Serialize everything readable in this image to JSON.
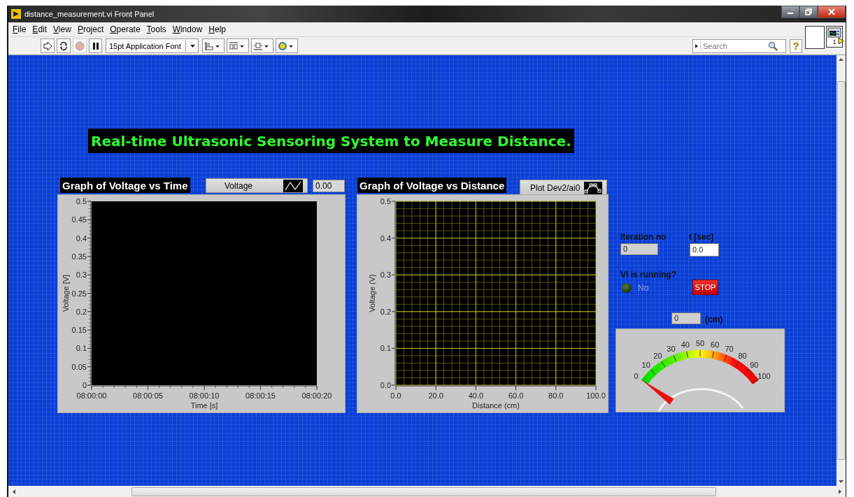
{
  "window": {
    "title": "distance_measurement.vi Front Panel"
  },
  "menu": [
    {
      "label": "File"
    },
    {
      "label": "Edit"
    },
    {
      "label": "View"
    },
    {
      "label": "Project"
    },
    {
      "label": "Operate"
    },
    {
      "label": "Tools"
    },
    {
      "label": "Window"
    },
    {
      "label": "Help"
    }
  ],
  "toolbar": {
    "abort_enabled": false,
    "font": "15pt Application Font",
    "search": {
      "placeholder": "Search"
    },
    "help": "?",
    "vi_icon_number": "1"
  },
  "panel": {
    "banner": "Real-time Ultrasonic Sensoring System to Measure Distance.",
    "graphs": [
      {
        "label": "Graph of Voltage vs Time",
        "legend": "Voltage",
        "kind": "line",
        "value": "0.00",
        "chart_data": {
          "type": "line",
          "grid": false,
          "xlabel": "Time [s]",
          "ylabel": "Voltage [V]",
          "ylim": [
            0,
            0.5
          ],
          "categories": [
            "08:00:00",
            "08:00:05",
            "08:00:10",
            "08:00:15",
            "08:00:20"
          ],
          "yticks": [
            0,
            0.05,
            0.1,
            0.15,
            0.2,
            0.25,
            0.3,
            0.35,
            0.4,
            0.45,
            0.5
          ]
        }
      },
      {
        "label": "Graph of Voltage vs Distance",
        "legend": "Plot Dev2/ai0",
        "kind": "points",
        "chart_data": {
          "type": "line",
          "grid": true,
          "xlabel": "Distance (cm)",
          "ylabel": "Voltage (V)",
          "xlim": [
            0,
            100
          ],
          "ylim": [
            0,
            0.5
          ],
          "xticks": [
            {
              "value": 0,
              "label": "0.0"
            },
            {
              "value": 20,
              "label": "20.0"
            },
            {
              "value": 40,
              "label": "40.0"
            },
            {
              "value": 60,
              "label": "60.0"
            },
            {
              "value": 80,
              "label": "80.0"
            },
            {
              "value": 100,
              "label": "100.0"
            }
          ],
          "yticks": [
            {
              "value": 0,
              "label": "0.0"
            },
            {
              "value": 0.1,
              "label": "0.1"
            },
            {
              "value": 0.2,
              "label": "0.2"
            },
            {
              "value": 0.3,
              "label": "0.3"
            },
            {
              "value": 0.4,
              "label": "0.4"
            },
            {
              "value": 0.5,
              "label": "0.5"
            }
          ]
        }
      }
    ],
    "iteration": {
      "label": "Iteration no",
      "value": "0"
    },
    "time": {
      "label": "t [sec]",
      "value": "0.0"
    },
    "running": {
      "label": "VI is running?",
      "on": false,
      "text": "No"
    },
    "stop_button": "STOP",
    "distance": {
      "value": "0",
      "unit": "(cm)"
    },
    "gauge": {
      "scale": [
        "0",
        "10",
        "20",
        "30",
        "40",
        "50",
        "60",
        "70",
        "80",
        "90",
        "100"
      ]
    }
  }
}
